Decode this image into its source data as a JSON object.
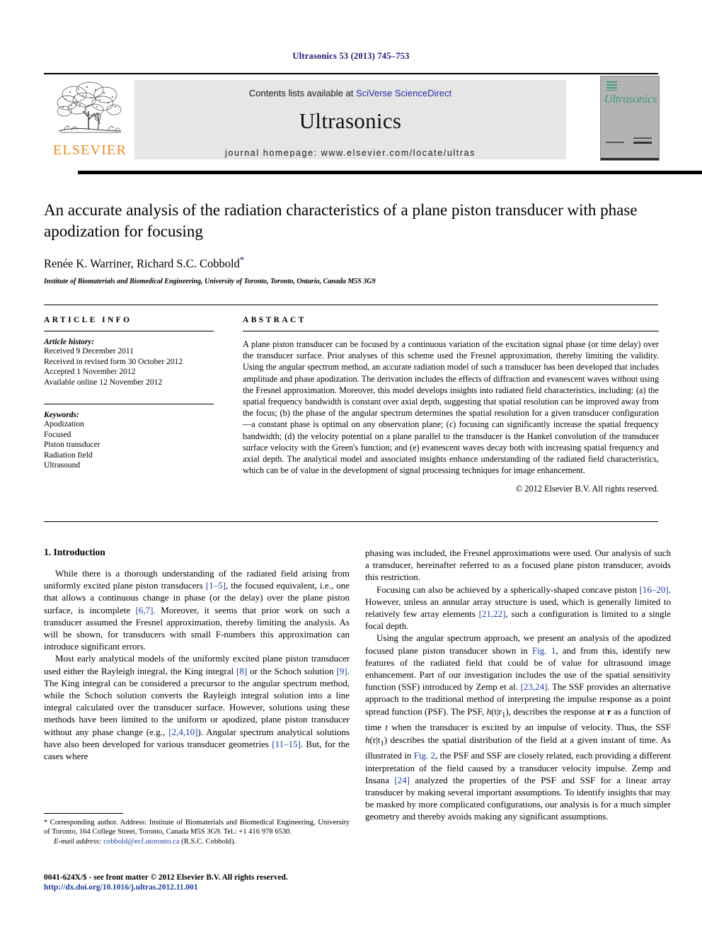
{
  "running_head": "Ultrasonics 53 (2013) 745–753",
  "masthead": {
    "publisher_name": "ELSEVIER",
    "contents_prefix": "Contents lists available at ",
    "contents_link": "SciVerse ScienceDirect",
    "journal_title": "Ultrasonics",
    "homepage": "journal homepage: www.elsevier.com/locate/ultras",
    "cover_script": "Ultrasonics"
  },
  "article": {
    "title": "An accurate analysis of the radiation characteristics of a plane piston transducer with phase apodization for focusing",
    "authors": "Renée K. Warriner, Richard S.C. Cobbold",
    "corresponding_marker": "*",
    "affiliation": "Institute of Biomaterials and Biomedical Engineering, University of Toronto, Toronto, Ontario, Canada M5S 3G9"
  },
  "article_info": {
    "heading": "ARTICLE INFO",
    "history_label": "Article history:",
    "history": [
      "Received 9 December 2011",
      "Received in revised form 30 October 2012",
      "Accepted 1 November 2012",
      "Available online 12 November 2012"
    ],
    "keywords_label": "Keywords:",
    "keywords": [
      "Apodization",
      "Focused",
      "Piston transducer",
      "Radiation field",
      "Ultrasound"
    ]
  },
  "abstract": {
    "heading": "ABSTRACT",
    "text": "A plane piston transducer can be focused by a continuous variation of the excitation signal phase (or time delay) over the transducer surface. Prior analyses of this scheme used the Fresnel approximation, thereby limiting the validity. Using the angular spectrum method, an accurate radiation model of such a transducer has been developed that includes amplitude and phase apodization. The derivation includes the effects of diffraction and evanescent waves without using the Fresnel approximation. Moreover, this model develops insights into radiated field characteristics, including: (a) the spatial frequency bandwidth is constant over axial depth, suggesting that spatial resolution can be improved away from the focus; (b) the phase of the angular spectrum determines the spatial resolution for a given transducer configuration—a constant phase is optimal on any observation plane; (c) focusing can significantly increase the spatial frequency bandwidth; (d) the velocity potential on a plane parallel to the transducer is the Hankel convolution of the transducer surface velocity with the Green's function; and (e) evanescent waves decay both with increasing spatial frequency and axial depth. The analytical model and associated insights enhance understanding of the radiated field characteristics, which can be of value in the development of signal processing techniques for image enhancement.",
    "copyright": "© 2012 Elsevier B.V. All rights reserved."
  },
  "body": {
    "section_heading": "1. Introduction",
    "left_p1_a": "While there is a thorough understanding of the radiated field arising from uniformly excited plane piston transducers ",
    "left_p1_cite1": "[1–5]",
    "left_p1_b": ", the focused equivalent, i.e., one that allows a continuous change in phase (or the delay) over the plane piston surface, is incomplete ",
    "left_p1_cite2": "[6,7]",
    "left_p1_c": ". Moreover, it seems that prior work on such a transducer assumed the Fresnel approximation, thereby limiting the analysis. As will be shown, for transducers with small F-numbers this approximation can introduce significant errors.",
    "left_p2_a": "Most early analytical models of the uniformly excited plane piston transducer used either the Rayleigh integral, the King integral ",
    "left_p2_cite1": "[8]",
    "left_p2_b": " or the Schoch solution ",
    "left_p2_cite2": "[9]",
    "left_p2_c": ". The King integral can be considered a precursor to the angular spectrum method, while the Schoch solution converts the Rayleigh integral solution into a line integral calculated over the transducer surface. However, solutions using these methods have been limited to the uniform or apodized, plane piston transducer without any phase change (e.g., ",
    "left_p2_cite3": "[2,4,10]",
    "left_p2_d": "). Angular spectrum analytical solutions have also been developed for various transducer geometries ",
    "left_p2_cite4": "[11–15]",
    "left_p2_e": ". But, for the cases where",
    "right_p1": "phasing was included, the Fresnel approximations were used. Our analysis of such a transducer, hereinafter referred to as a focused plane piston transducer, avoids this restriction.",
    "right_p2_a": "Focusing can also be achieved by a spherically-shaped concave piston ",
    "right_p2_cite1": "[16–20]",
    "right_p2_b": ". However, unless an annular array structure is used, which is generally limited to relatively few array elements ",
    "right_p2_cite2": "[21,22]",
    "right_p2_c": ", such a configuration is limited to a single focal depth.",
    "right_p3_a": "Using the angular spectrum approach, we present an analysis of the apodized focused plane piston transducer shown in ",
    "right_p3_figref1": "Fig. 1",
    "right_p3_b": ", and from this, identify new features of the radiated field that could be of value for ultrasound image enhancement. Part of our investigation includes the use of the spatial sensitivity function (SSF) introduced by Zemp et al. ",
    "right_p3_cite1": "[23,24]",
    "right_p3_c": ". The SSF provides an alternative approach to the traditional method of interpreting the impulse response as a point spread function (PSF). The PSF, ",
    "right_p3_math1": "h",
    "right_p3_math1b": "(t|r",
    "right_p3_math1sub": "1",
    "right_p3_math1c": "), ",
    "right_p3_d": "describes the response at ",
    "right_p3_math2": "r",
    "right_p3_e": " as a function of time ",
    "right_p3_math3": "t",
    "right_p3_f": " when the transducer is excited by an impulse of velocity. Thus, the SSF ",
    "right_p3_math4": "h",
    "right_p3_math4b": "(r|t",
    "right_p3_math4sub": "1",
    "right_p3_math4c": ") ",
    "right_p3_g": "describes the spatial distribution of the field at a given instant of time. As illustrated in ",
    "right_p3_figref2": "Fig. 2",
    "right_p3_h": ", the PSF and SSF are closely related, each providing a different interpretation of the field caused by a transducer velocity impulse. Zemp and Insana ",
    "right_p3_cite2": "[24]",
    "right_p3_i": " analyzed the properties of the PSF and SSF for a linear array transducer by making several important assumptions. To identify insights that may be masked by more complicated configurations, our analysis is for a much simpler geometry and thereby avoids making any significant assumptions."
  },
  "footnotes": {
    "corresponding_star": "*",
    "corresponding": " Corresponding author. Address: Institute of Biomaterials and Biomedical Engineering, University of Toronto, 164 College Street, Toronto, Canada M5S 3G9. Tel.: +1 416 978 6530.",
    "email_label": "E-mail address:",
    "email": "cobbold@ecf.utoronto.ca",
    "email_suffix": " (R.S.C. Cobbold)."
  },
  "page_footer": {
    "issn": "0041-624X/$ - see front matter © 2012 Elsevier B.V. All rights reserved.",
    "doi": "http://dx.doi.org/10.1016/j.ultras.2012.11.001"
  },
  "colors": {
    "link": "#1a3fa0",
    "running_head": "#1a1a6e",
    "elsevier_orange": "#f08a22",
    "cover_green": "#3f9c7d",
    "banner_bg": "#e6e6e6"
  }
}
